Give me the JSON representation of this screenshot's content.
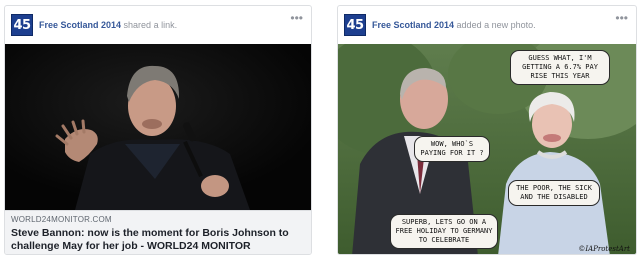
{
  "posts": [
    {
      "page_avatar": "45",
      "author": "Free Scotland 2014",
      "action": " shared a link.",
      "more_label": "•••",
      "link": {
        "domain": "WORLD24MONITOR.COM",
        "title": "Steve Bannon: now is the moment for Boris Johnson to challenge May for her job - WORLD24 MONITOR"
      }
    },
    {
      "page_avatar": "45",
      "author": "Free Scotland 2014",
      "action": " added a new photo.",
      "more_label": "•••",
      "photo": {
        "bubbles": [
          "GUESS WHAT, I'M GETTING A 6.7% PAY RISE THIS YEAR",
          "WOW, WHO`S PAYING FOR IT ?",
          "THE POOR, THE SICK AND THE DISABLED",
          "SUPERB, LETS GO ON A FREE HOLIDAY TO GERMANY TO CELEBRATE"
        ],
        "credit": "©IAProtestArt"
      }
    }
  ],
  "colors": {
    "avatar_bg": "#1d3f8f",
    "link_blue": "#365899",
    "meta_bg": "#f2f3f5"
  }
}
